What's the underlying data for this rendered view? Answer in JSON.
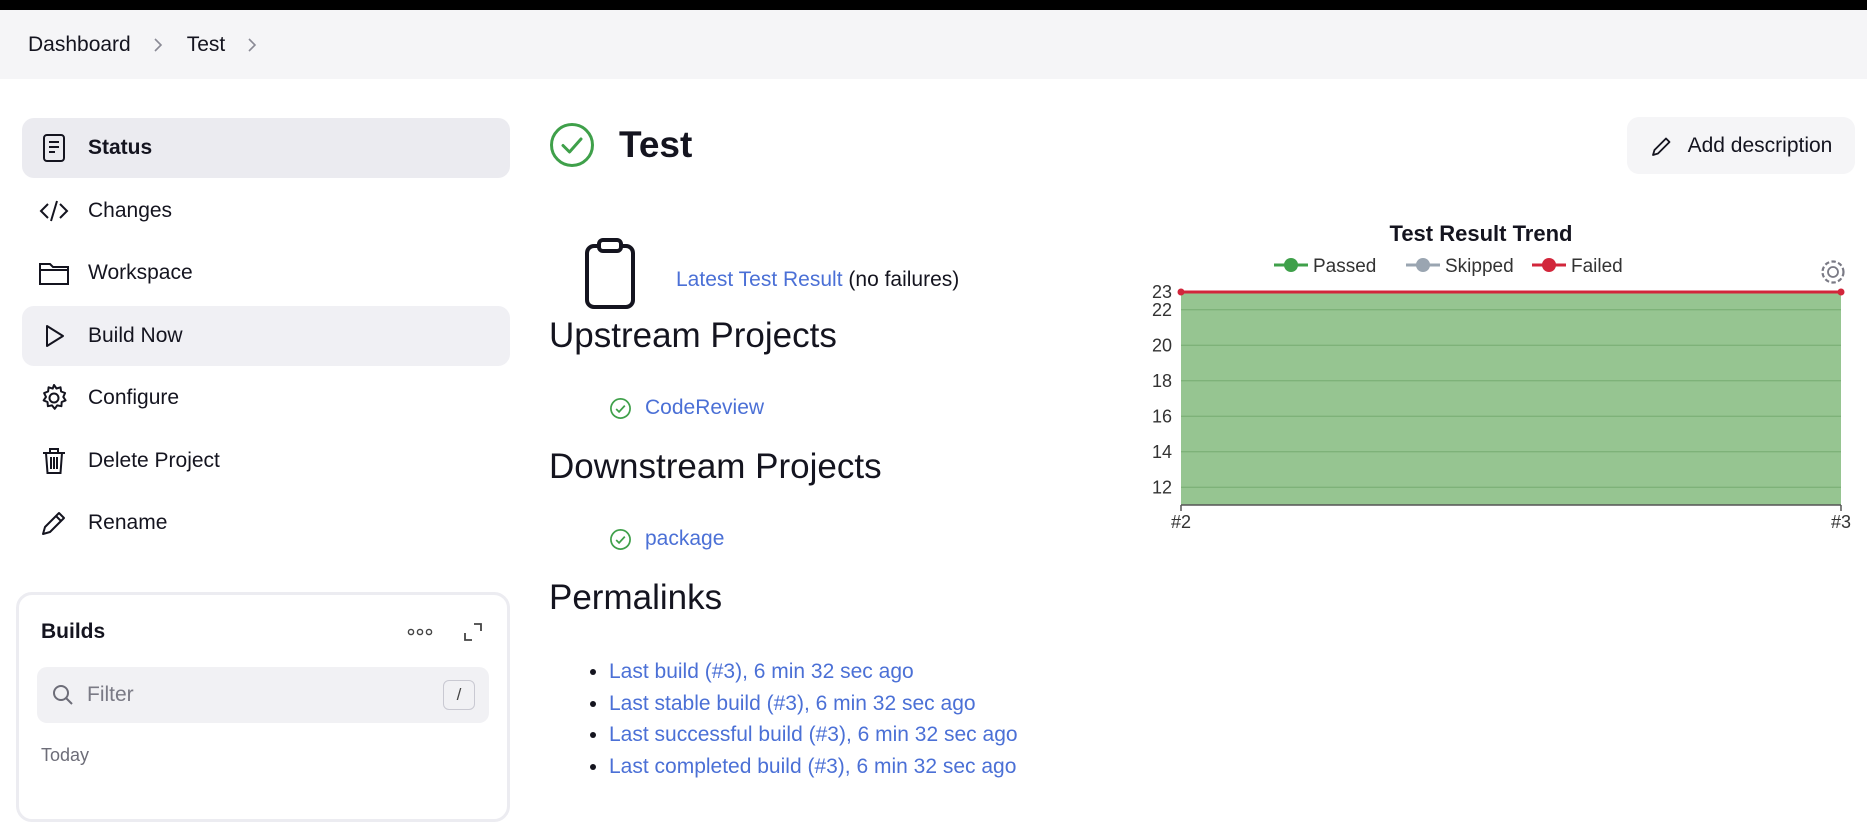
{
  "breadcrumbs": [
    "Dashboard",
    "Test"
  ],
  "sidebar": {
    "tasks": [
      {
        "label": "Status",
        "icon": "status-icon"
      },
      {
        "label": "Changes",
        "icon": "code-icon"
      },
      {
        "label": "Workspace",
        "icon": "folder-icon"
      },
      {
        "label": "Build Now",
        "icon": "play-icon"
      },
      {
        "label": "Configure",
        "icon": "gear-icon"
      },
      {
        "label": "Delete Project",
        "icon": "trash-icon"
      },
      {
        "label": "Rename",
        "icon": "pencil-icon"
      }
    ],
    "builds": {
      "title": "Builds",
      "filter_placeholder": "Filter",
      "shortcut": "/",
      "group_label": "Today"
    }
  },
  "page": {
    "title": "Test",
    "add_description": "Add description",
    "latest_test_result": "Latest Test Result",
    "latest_note": "(no failures)",
    "upstream_heading": "Upstream Projects",
    "upstream": [
      "CodeReview"
    ],
    "downstream_heading": "Downstream Projects",
    "downstream": [
      "package"
    ],
    "permalinks_heading": "Permalinks",
    "permalinks": [
      "Last build (#3), 6 min 32 sec ago",
      "Last stable build (#3), 6 min 32 sec ago",
      "Last successful build (#3), 6 min 32 sec ago",
      "Last completed build (#3), 6 min 32 sec ago"
    ]
  },
  "colors": {
    "success": "#3fa04a",
    "link": "#4b70d6",
    "passed": "#8dc088",
    "failed": "#d2263b",
    "skipped": "#9aa5b1"
  },
  "chart_data": {
    "type": "area",
    "title": "Test Result Trend",
    "legend": [
      "Passed",
      "Skipped",
      "Failed"
    ],
    "categories": [
      "#2",
      "#3"
    ],
    "series": [
      {
        "name": "Passed",
        "values": [
          23,
          23
        ]
      },
      {
        "name": "Skipped",
        "values": [
          0,
          0
        ]
      },
      {
        "name": "Failed",
        "values": [
          0,
          0
        ]
      }
    ],
    "yticks": [
      12,
      14,
      16,
      18,
      20,
      22,
      23
    ],
    "ylim": [
      11,
      23
    ],
    "legend_position": "top",
    "grid": true
  }
}
